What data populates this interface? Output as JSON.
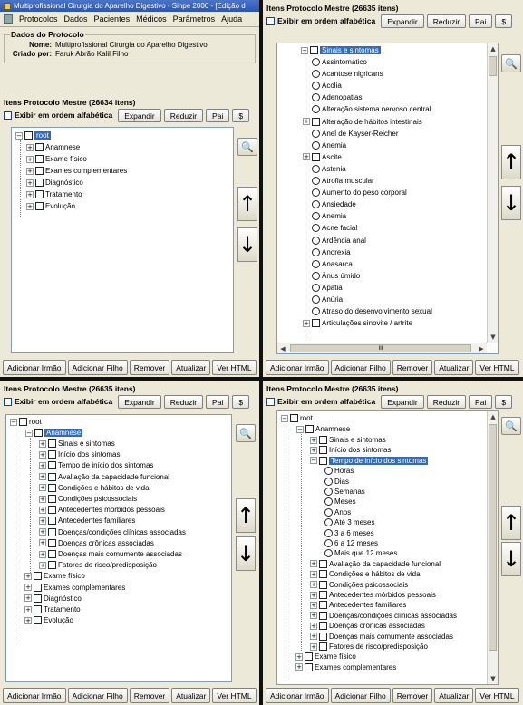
{
  "window": {
    "title": "Multiprofissional Cirurgia do Aparelho Digestivo - Sinpe 2006 - [Edição d"
  },
  "menu": [
    "Protocolos",
    "Dados",
    "Pacientes",
    "Médicos",
    "Parâmetros",
    "Ajuda"
  ],
  "dados": {
    "legend": "Dados do Protocolo",
    "nome_label": "Nome:",
    "nome_value": "Multiprofissional Cirurgia do Aparelho Digestivo",
    "criado_label": "Criado por:",
    "criado_value": "Faruk Abrão Kalil Filho"
  },
  "toolbar": {
    "checkbox_label": "Exibir em ordem alfabética",
    "expandir": "Expandir",
    "reduzir": "Reduzir",
    "pai": "Pai",
    "dollar": "$"
  },
  "bottom": {
    "irmao": "Adicionar Irmão",
    "filho": "Adicionar Filho",
    "remover": "Remover",
    "atualizar": "Atualizar",
    "ver_html": "Ver HTML"
  },
  "p1": {
    "header": "Itens Protocolo Mestre (26634 itens)",
    "root": "root",
    "children": [
      "Anamnese",
      "Exame físico",
      "Exames complementares",
      "Diagnóstico",
      "Tratamento",
      "Evolução"
    ]
  },
  "p2": {
    "header": "Itens Protocolo Mestre (26635 itens)",
    "selected": "Sinais e sintomas",
    "items": [
      "Assintomático",
      "Acantose nigricans",
      "Acolia",
      "Adenopatias",
      "Alteração sistema nervoso central",
      "Alteração de hábitos intestinais",
      "Anel de Kayser-Reicher",
      "Anemia",
      "Ascite",
      "Astenia",
      "Atrofia muscular",
      "Aumento do peso corporal",
      "Ansiedade",
      "Anemia",
      "Acne facial",
      "Ardência anal",
      "Anorexia",
      "Anasarca",
      "Ânus úmido",
      "Apatia",
      "Anúria",
      "Atraso do desenvolvimento sexual",
      "Articulações sinovite / artrite"
    ],
    "scroll_mid": "III"
  },
  "p3": {
    "header": "Itens Protocolo Mestre (26635 itens)",
    "root": "root",
    "selected": "Anamnese",
    "anamnese_children": [
      "Sinais e sintomas",
      "Início dos sintomas",
      "Tempo de início dos sintomas",
      "Avaliação da capacidade funcional",
      "Condições e hábitos de vida",
      "Condições psicossociais",
      "Antecedentes mórbidos pessoais",
      "Antecedentes familiares",
      "Doenças/condições clínicas associadas",
      "Doenças crônicas associadas",
      "Doenças mais comumente associadas",
      "Fatores de risco/predisposição"
    ],
    "others": [
      "Exame físico",
      "Exames complementares",
      "Diagnóstico",
      "Tratamento",
      "Evolução"
    ]
  },
  "p4": {
    "header": "Itens Protocolo Mestre (26635 itens)",
    "root": "root",
    "anamnese": "Anamnese",
    "before": [
      "Sinais e sintomas",
      "Início dos sintomas"
    ],
    "selected": "Tempo de início dos sintomas",
    "options": [
      "Horas",
      "Dias",
      "Semanas",
      "Meses",
      "Anos",
      "Até 3 meses",
      "3 a 6 meses",
      "6 a 12 meses",
      "Mais que 12 meses"
    ],
    "after": [
      "Avaliação da capacidade funcional",
      "Condições e hábitos de vida",
      "Condições psicossociais",
      "Antecedentes mórbidos pessoais",
      "Antecedentes familiares",
      "Doenças/condições clínicas associadas",
      "Doenças crônicas associadas",
      "Doenças mais comumente associadas",
      "Fatores de risco/predisposição"
    ],
    "others": [
      "Exame físico",
      "Exames complementares"
    ]
  }
}
